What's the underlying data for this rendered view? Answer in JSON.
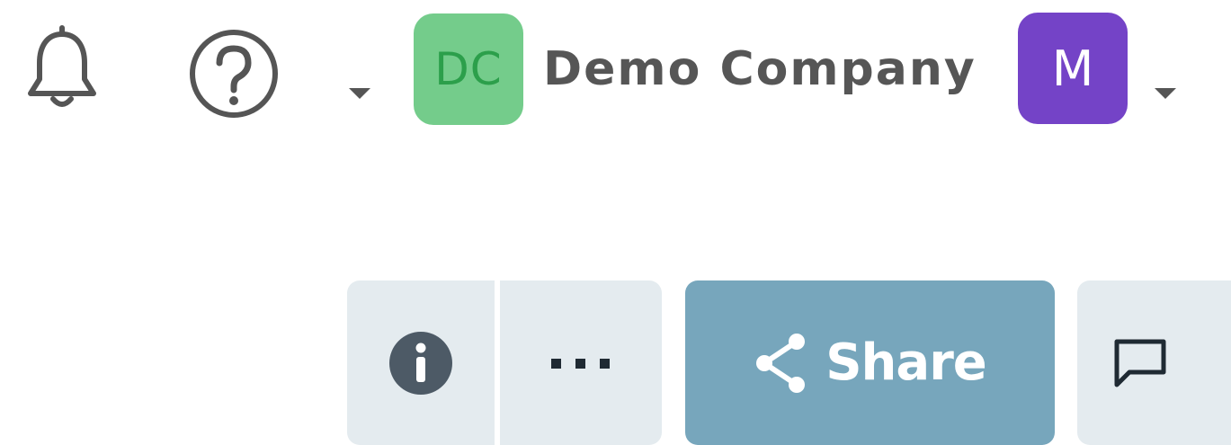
{
  "header": {
    "company": {
      "initials": "DC",
      "name": "Demo Company"
    },
    "user": {
      "initial": "M"
    },
    "icons": {
      "notifications": "bell-icon",
      "help": "question-circle-icon",
      "help_menu": "chevron-down-icon",
      "user_menu": "chevron-down-icon"
    }
  },
  "toolbar": {
    "info_icon": "info-circle-icon",
    "more_icon": "ellipsis-icon",
    "share_icon": "share-icon",
    "share_label": "Share",
    "comment_icon": "comment-icon"
  },
  "colors": {
    "company_avatar_bg": "#74cc8b",
    "company_avatar_text": "#2c9f4b",
    "user_avatar_bg": "#7443c7",
    "share_button_bg": "#77a6bc",
    "secondary_button_bg": "#e4ebef"
  }
}
